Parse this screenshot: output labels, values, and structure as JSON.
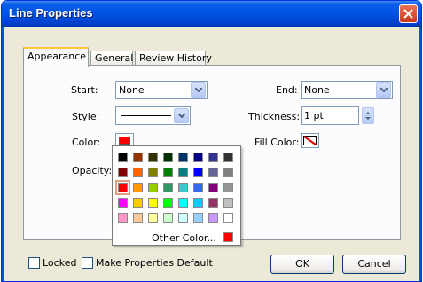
{
  "window": {
    "title": "Line Properties"
  },
  "tabs": [
    {
      "label": "Appearance",
      "active": true
    },
    {
      "label": "General",
      "active": false
    },
    {
      "label": "Review History",
      "active": false
    }
  ],
  "appearance": {
    "start": {
      "label": "Start:",
      "value": "None"
    },
    "end": {
      "label": "End:",
      "value": "None"
    },
    "style": {
      "label": "Style:"
    },
    "thickness": {
      "label": "Thickness:",
      "value": "1 pt"
    },
    "color": {
      "label": "Color:",
      "value": "#FF0000"
    },
    "fill_color": {
      "label": "Fill Color:",
      "value": "none"
    },
    "opacity": {
      "label": "Opacity:"
    }
  },
  "color_palette": {
    "selected": "#FF0000",
    "rows": [
      [
        "#000000",
        "#993300",
        "#333300",
        "#003300",
        "#003366",
        "#000080",
        "#333399",
        "#333333"
      ],
      [
        "#800000",
        "#FF6600",
        "#808000",
        "#008000",
        "#008080",
        "#0000FF",
        "#666699",
        "#808080"
      ],
      [
        "#FF0000",
        "#FF9900",
        "#99CC00",
        "#339966",
        "#33CCCC",
        "#3366FF",
        "#800080",
        "#969696"
      ],
      [
        "#FF00FF",
        "#FFCC00",
        "#FFFF00",
        "#00FF00",
        "#00FFFF",
        "#00CCFF",
        "#993366",
        "#C0C0C0"
      ],
      [
        "#FF99CC",
        "#FFCC99",
        "#FFFF99",
        "#CCFFCC",
        "#CCFFFF",
        "#99CCFF",
        "#CC99FF",
        "#FFFFFF"
      ]
    ],
    "other_color_label": "Other Color...",
    "other_color_value": "#FF0000"
  },
  "footer": {
    "locked_label": "Locked",
    "make_default_label": "Make Properties Default",
    "ok_label": "OK",
    "cancel_label": "Cancel"
  }
}
